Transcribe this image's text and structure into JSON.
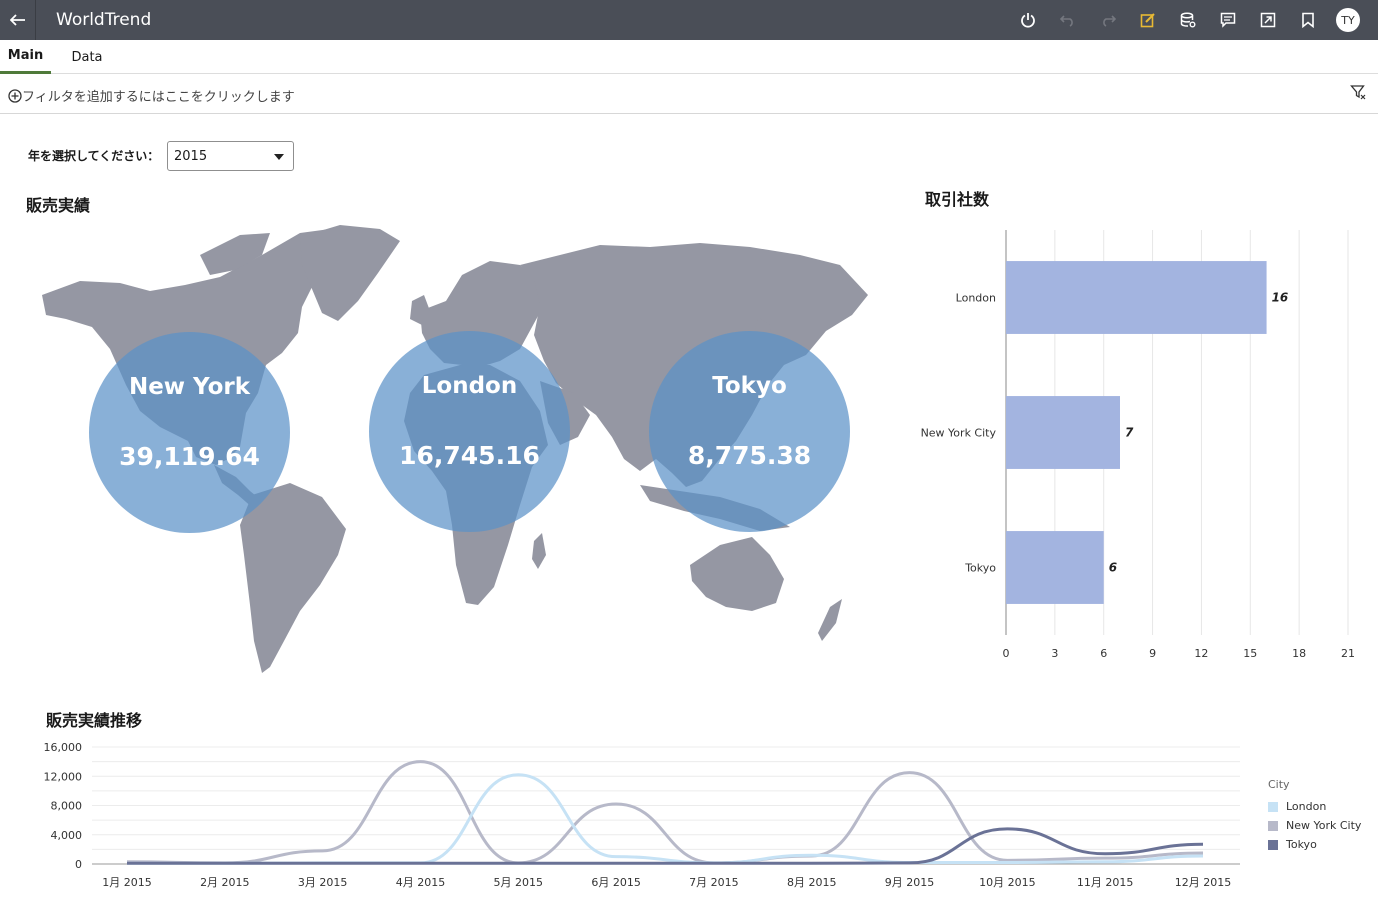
{
  "app": {
    "title": "WorldTrend",
    "avatar": "TY"
  },
  "toolbar": {
    "icons": [
      "power-icon",
      "undo-icon",
      "redo-icon",
      "edit-icon",
      "data-source-icon",
      "comment-icon",
      "export-icon",
      "bookmark-icon"
    ]
  },
  "tabs": [
    {
      "label": "Main",
      "active": true
    },
    {
      "label": "Data",
      "active": false
    }
  ],
  "filter": {
    "add_label": "フィルタを追加するにはここをクリックします"
  },
  "year": {
    "label": "年を選択してください：",
    "value": "2015"
  },
  "titles": {
    "sales": "販売実績",
    "partners": "取引社数",
    "trend": "販売実績推移"
  },
  "colors": {
    "topbar": "#4a4e57",
    "bubble": "#5b92c8",
    "bar": "#a3b4e0",
    "london": "#c6e2f5",
    "nyc": "#b7b9c9",
    "tokyo": "#6a7296",
    "land": "#9597a3",
    "edit_icon": "#e8b934"
  },
  "bubbles": [
    {
      "city": "New York",
      "value": "39,119.64"
    },
    {
      "city": "London",
      "value": "16,745.16"
    },
    {
      "city": "Tokyo",
      "value": "8,775.38"
    }
  ],
  "chart_data": [
    {
      "type": "bar",
      "orientation": "horizontal",
      "title": "取引社数",
      "categories": [
        "London",
        "New York City",
        "Tokyo"
      ],
      "values": [
        16,
        7,
        6
      ],
      "xlim": [
        0,
        21
      ],
      "xticks": [
        0,
        3,
        6,
        9,
        12,
        15,
        18,
        21
      ],
      "grid": true
    },
    {
      "type": "line",
      "title": "販売実績推移",
      "x": [
        "1月 2015",
        "2月 2015",
        "3月 2015",
        "4月 2015",
        "5月 2015",
        "6月 2015",
        "7月 2015",
        "8月 2015",
        "9月 2015",
        "10月 2015",
        "11月 2015",
        "12月 2015"
      ],
      "ylim": [
        0,
        16000
      ],
      "yticks": [
        "0",
        "4,000",
        "8,000",
        "12,000",
        "16,000"
      ],
      "legend_title": "City",
      "legend_position": "right",
      "series": [
        {
          "name": "London",
          "values": [
            100,
            100,
            150,
            150,
            12200,
            1000,
            150,
            1200,
            200,
            200,
            300,
            1100
          ]
        },
        {
          "name": "New York City",
          "values": [
            300,
            150,
            1800,
            14000,
            150,
            8200,
            150,
            1100,
            12500,
            500,
            800,
            1500
          ]
        },
        {
          "name": "Tokyo",
          "values": [
            100,
            100,
            100,
            100,
            100,
            100,
            100,
            100,
            150,
            4800,
            1400,
            2700
          ]
        }
      ]
    }
  ]
}
